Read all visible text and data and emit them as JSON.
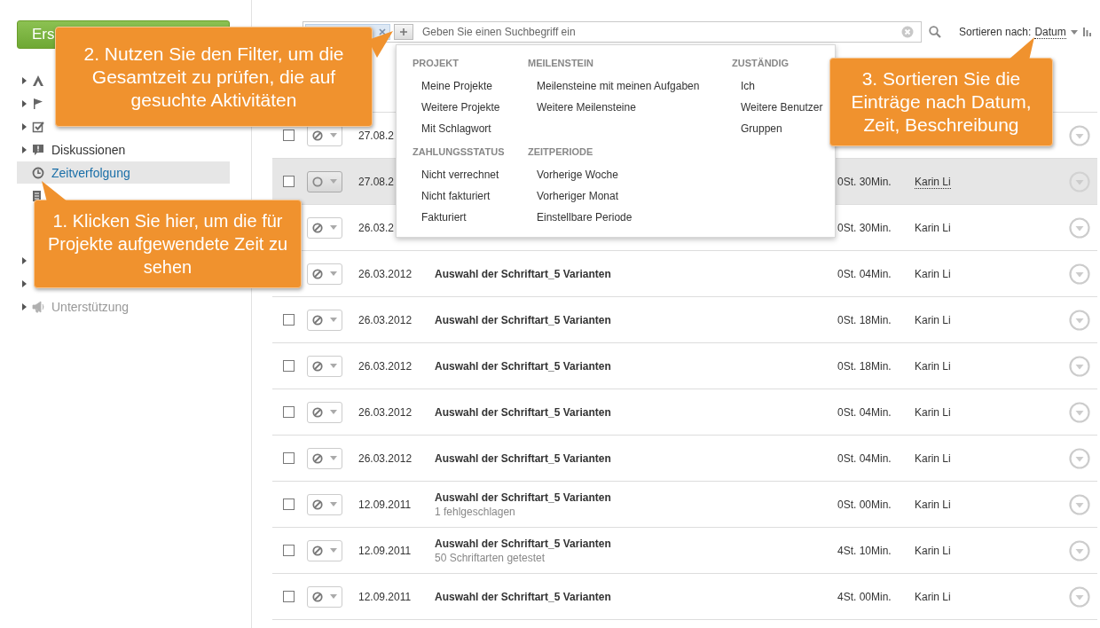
{
  "sidebar": {
    "create_button": {
      "label": "Ers"
    },
    "sections": [
      {
        "items": [
          {
            "expandable": true,
            "selected": false,
            "disabled": false
          },
          {
            "expandable": true,
            "selected": false,
            "disabled": false
          },
          {
            "expandable": true,
            "selected": false,
            "disabled": false
          },
          {
            "label": "Diskussionen",
            "expandable": true,
            "selected": false,
            "disabled": false
          },
          {
            "label": "Zeitverfolgung",
            "expandable": false,
            "selected": true,
            "disabled": false
          },
          {
            "expandable": false,
            "selected": false,
            "disabled": false
          }
        ]
      },
      {
        "items": [
          {
            "expandable": true,
            "selected": false,
            "disabled": false
          },
          {
            "expandable": true,
            "selected": false,
            "disabled": false
          },
          {
            "label": "Unterstützung",
            "expandable": true,
            "selected": false,
            "disabled": true
          }
        ]
      }
    ]
  },
  "toolbar": {
    "search": {
      "placeholder": "Geben Sie einen Suchbegriff ein"
    },
    "sort": {
      "label": "Sortieren nach:",
      "value": "Datum"
    }
  },
  "filter_menu": {
    "groups": [
      {
        "heading": "PROJEKT",
        "items": [
          "Meine Projekte",
          "Weitere Projekte",
          "Mit Schlagwort"
        ]
      },
      {
        "heading": "MEILENSTEIN",
        "items": [
          "Meilensteine mit meinen Aufgaben",
          "Weitere Meilensteine"
        ]
      },
      {
        "heading": "ZUSTÄNDIG",
        "items": [
          "Ich",
          "Weitere Benutzer",
          "Gruppen"
        ]
      },
      {
        "heading": "ZAHLUNGSSTATUS",
        "items": [
          "Nicht verrechnet",
          "Nicht fakturiert",
          "Fakturiert"
        ]
      },
      {
        "heading": "ZEITPERIODE",
        "items": [
          "Vorherige Woche",
          "Vorheriger Monat",
          "Einstellbare Periode"
        ]
      }
    ]
  },
  "rows": [
    {
      "checked": false,
      "selected": false,
      "cancelled": true,
      "date": "27.08.2"
    },
    {
      "checked": false,
      "selected": true,
      "cancelled": false,
      "date": "27.08.2",
      "time": "0St. 30Min.",
      "user": "Karin Li"
    },
    {
      "selected": false,
      "cancelled": true,
      "date": "26.03.2",
      "time": "0St. 30Min.",
      "user": "Karin Li"
    },
    {
      "selected": false,
      "cancelled": true,
      "date": "26.03.2012",
      "title": "Auswahl der Schriftart_5 Varianten",
      "time": "0St. 04Min.",
      "user": "Karin Li"
    },
    {
      "checked": false,
      "selected": false,
      "cancelled": true,
      "date": "26.03.2012",
      "title": "Auswahl der Schriftart_5 Varianten",
      "time": "0St. 18Min.",
      "user": "Karin Li"
    },
    {
      "checked": false,
      "selected": false,
      "cancelled": true,
      "date": "26.03.2012",
      "title": "Auswahl der Schriftart_5 Varianten",
      "time": "0St. 18Min.",
      "user": "Karin Li"
    },
    {
      "checked": false,
      "selected": false,
      "cancelled": true,
      "date": "26.03.2012",
      "title": "Auswahl der Schriftart_5 Varianten",
      "time": "0St. 04Min.",
      "user": "Karin Li"
    },
    {
      "checked": false,
      "selected": false,
      "cancelled": true,
      "date": "26.03.2012",
      "title": "Auswahl der Schriftart_5 Varianten",
      "time": "0St. 04Min.",
      "user": "Karin Li"
    },
    {
      "checked": false,
      "selected": false,
      "cancelled": true,
      "date": "12.09.2011",
      "title": "Auswahl der Schriftart_5 Varianten",
      "note": "1 fehlgeschlagen",
      "time": "0St. 00Min.",
      "user": "Karin Li"
    },
    {
      "checked": false,
      "selected": false,
      "cancelled": true,
      "date": "12.09.2011",
      "title": "Auswahl der Schriftart_5 Varianten",
      "note": "50 Schriftarten getestet",
      "time": "4St. 10Min.",
      "user": "Karin Li"
    },
    {
      "checked": false,
      "selected": false,
      "cancelled": true,
      "date": "12.09.2011",
      "title": "Auswahl der Schriftart_5 Varianten",
      "time": "4St. 00Min.",
      "user": "Karin Li"
    }
  ],
  "callouts": [
    {
      "kind": "filter",
      "text": "2. Nutzen Sie den Filter, um die Gesamtzeit zu prüfen, die auf gesuchte Aktivitäten"
    },
    {
      "kind": "sidebar",
      "text": "1. Klicken Sie hier, um die für Projekte aufgewendete Zeit zu sehen"
    },
    {
      "kind": "sort",
      "text": "3. Sortieren Sie die Einträge nach Datum, Zeit, Beschreibung"
    }
  ]
}
